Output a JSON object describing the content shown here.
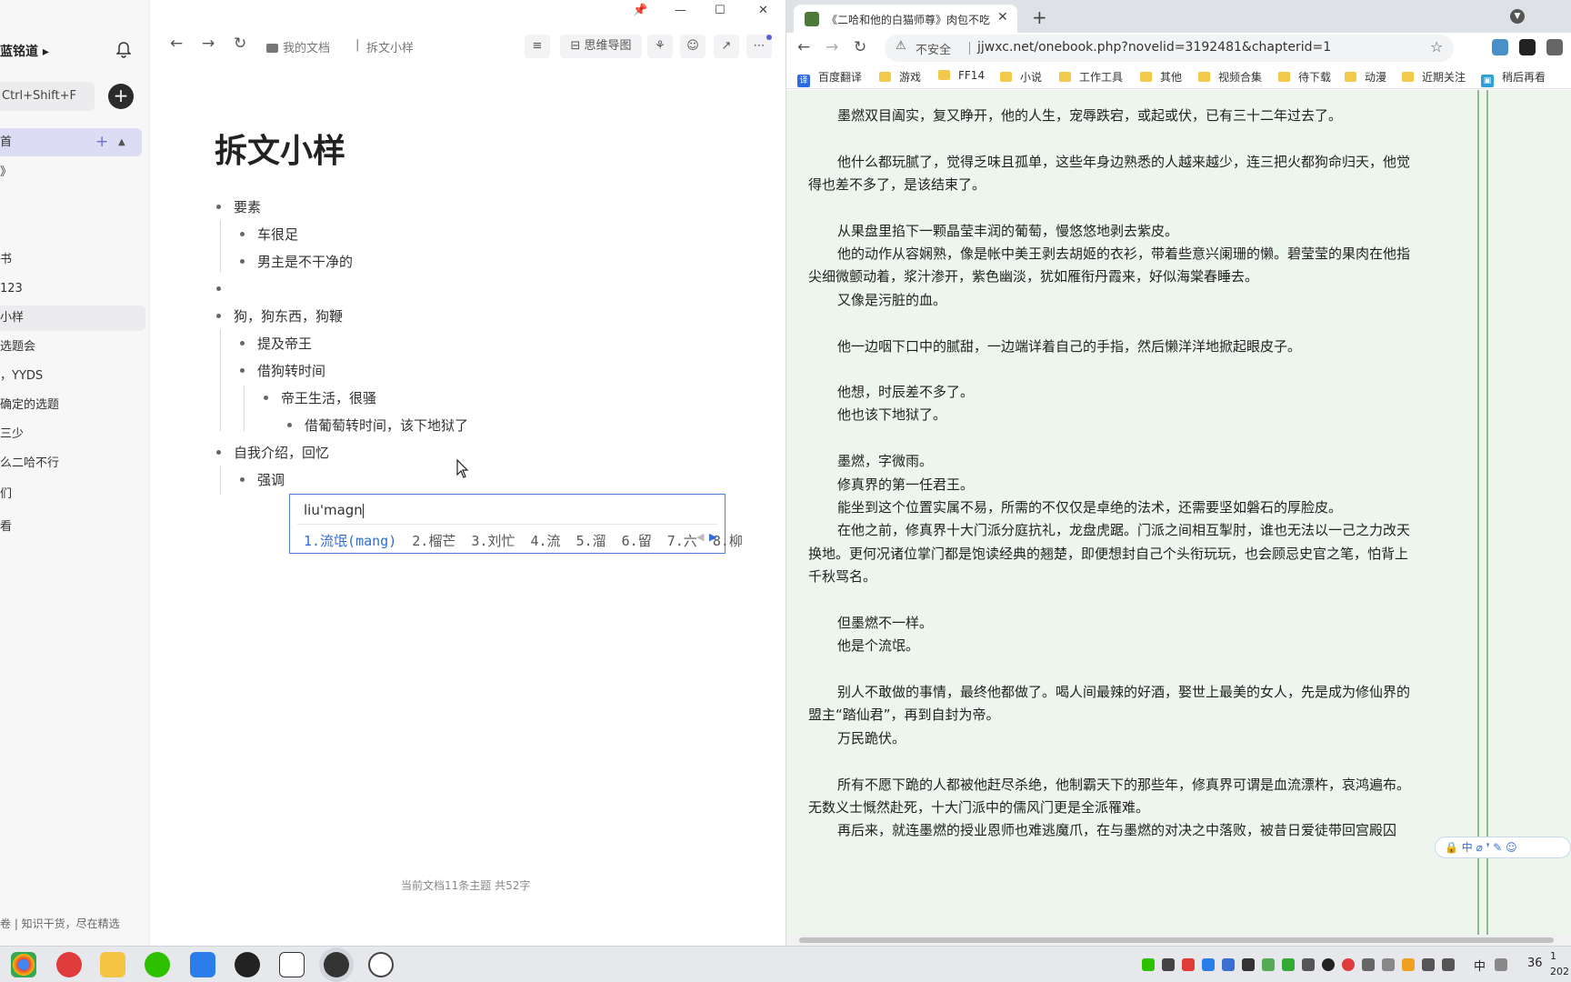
{
  "left_app": {
    "user_name": "蓝铭道 ▸",
    "search_shortcut": "Ctrl+Shift+F",
    "category_label": "首",
    "sidebar_items": [
      "》",
      "书",
      "123",
      "小样",
      "选题会",
      "，YYDS",
      "确定的选题",
      "三少",
      "么二哈不行",
      "们",
      "看"
    ],
    "footer_text": "卷 | 知识干货，尽在精选",
    "breadcrumb_root": "我的文档",
    "breadcrumb_current": "拆文小样",
    "mindmap_label": "思维导图",
    "doc_title": "拆文小样",
    "outline": [
      {
        "text": "要素"
      },
      {
        "text": "车很足"
      },
      {
        "text": "男主是不干净的"
      },
      {
        "text": ""
      },
      {
        "text": "狗，狗东西，狗鞭"
      },
      {
        "text": "提及帝王"
      },
      {
        "text": "借狗转时间"
      },
      {
        "text": "帝王生活，很骚"
      },
      {
        "text": "借葡萄转时间，该下地狱了"
      },
      {
        "text": "自我介绍，回忆"
      },
      {
        "text": "强调"
      }
    ],
    "ime": {
      "composition": "liu'magn",
      "candidates": [
        "1.流氓(mang)",
        "2.榴芒",
        "3.刘忙",
        "4.流",
        "5.溜",
        "6.留",
        "7.六",
        "8.柳"
      ]
    },
    "status_text": "当前文档11条主题 共52字"
  },
  "browser": {
    "tab_title": "《二哈和他的白猫师尊》肉包不吃肉",
    "insecure_label": "不安全",
    "url": "jjwxc.net/onebook.php?novelid=3192481&chapterid=1",
    "bookmarks": [
      "百度翻译",
      "游戏",
      "FF14",
      "小说",
      "工作工具",
      "其他",
      "视频合集",
      "待下载",
      "动漫",
      "近期关注",
      "稍后再看"
    ],
    "paragraph_lines": [
      {
        "text": "墨燃双目阖实，复又睁开，他的人生，宠辱跌宕，或起或伏，已有三十二年过去了。",
        "indent": true
      },
      {
        "text": "他什么都玩腻了，觉得乏味且孤单，这些年身边熟悉的人越来越少，连三把火都狗命归天，他觉",
        "indent": true
      },
      {
        "text": "得也差不多了，是该结束了。",
        "indent": false
      },
      {
        "text": "从果盘里掐下一颗晶莹丰润的葡萄，慢悠悠地剥去紫皮。",
        "indent": true
      },
      {
        "text": "他的动作从容娴熟，像是帐中美王剥去胡姬的衣衫，带着些意兴阑珊的懒。碧莹莹的果肉在他指",
        "indent": true
      },
      {
        "text": "尖细微颤动着，浆汁渗开，紫色幽淡，犹如雁衔丹霞来，好似海棠春睡去。",
        "indent": false
      },
      {
        "text": "又像是污脏的血。",
        "indent": true
      },
      {
        "text": "他一边咽下口中的腻甜，一边端详着自己的手指，然后懒洋洋地掀起眼皮子。",
        "indent": true
      },
      {
        "text": "他想，时辰差不多了。",
        "indent": true
      },
      {
        "text": "他也该下地狱了。",
        "indent": true
      },
      {
        "text": "墨燃，字微雨。",
        "indent": true
      },
      {
        "text": "修真界的第一任君王。",
        "indent": true
      },
      {
        "text": "能坐到这个位置实属不易，所需的不仅仅是卓绝的法术，还需要坚如磐石的厚脸皮。",
        "indent": true
      },
      {
        "text": "在他之前，修真界十大门派分庭抗礼，龙盘虎踞。门派之间相互掣肘，谁也无法以一己之力改天",
        "indent": true
      },
      {
        "text": "换地。更何况诸位掌门都是饱读经典的翘楚，即便想封自己个头衔玩玩，也会顾忌史官之笔，怕背上",
        "indent": false
      },
      {
        "text": "千秋骂名。",
        "indent": false
      },
      {
        "text": "但墨燃不一样。",
        "indent": true
      },
      {
        "text": "他是个流氓。",
        "indent": true
      },
      {
        "text": "别人不敢做的事情，最终他都做了。喝人间最辣的好酒，娶世上最美的女人，先是成为修仙界的",
        "indent": true
      },
      {
        "text": "盟主“踏仙君”，再到自封为帝。",
        "indent": false
      },
      {
        "text": "万民跪伏。",
        "indent": true
      },
      {
        "text": "所有不愿下跪的人都被他赶尽杀绝，他制霸天下的那些年，修真界可谓是血流漂杵，哀鸿遍布。",
        "indent": true
      },
      {
        "text": "无数义士慨然赴死，十大门派中的儒风门更是全派罹难。",
        "indent": false
      },
      {
        "text": "再后来，就连墨燃的授业恩师也难逃魔爪，在与墨燃的对决之中落败，被昔日爱徒带回宫殿囚",
        "indent": true
      }
    ],
    "ime_toolbar": "中 ⌀ ❜ ✎ ☺"
  },
  "taskbar": {
    "tray_ime": "中",
    "tray_battery": "36",
    "clock_line1": "1",
    "clock_line2": "202"
  }
}
